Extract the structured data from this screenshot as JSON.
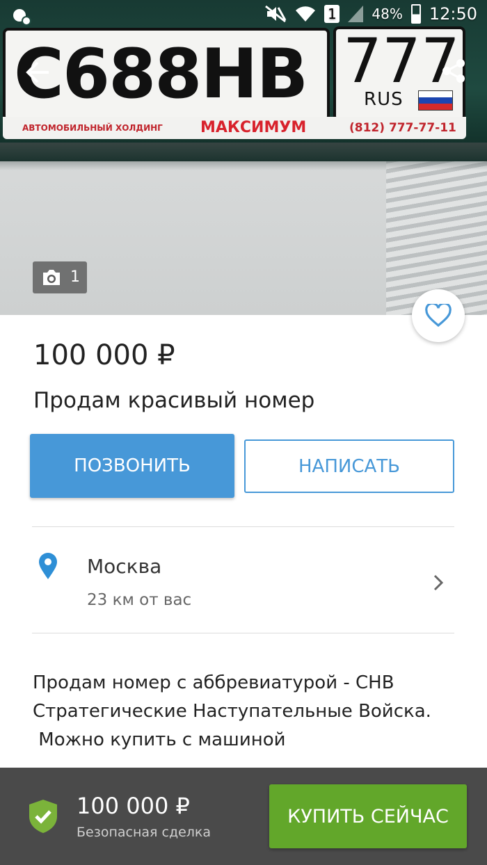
{
  "status_bar": {
    "battery": "48%",
    "time": "12:50",
    "sim": "1"
  },
  "photo": {
    "plate_number": "С688НВ",
    "plate_region": "777",
    "plate_country": "RUS",
    "frame_left": "АВТОМОБИЛЬНЫЙ ХОЛДИНГ",
    "frame_brand": "МАКСИМУМ",
    "frame_phone": "(812) 777-77-11",
    "photo_count": "1"
  },
  "listing": {
    "price": "100 000 ₽",
    "title": "Продам красивый номер"
  },
  "actions": {
    "call_label": "ПОЗВОНИТЬ",
    "write_label": "НАПИСАТЬ"
  },
  "location": {
    "city": "Москва",
    "distance": "23 км от вас"
  },
  "description": "Продам номер с аббревиатурой - СНВ\nСтратегические Наступательные Войска.\n Можно купить с машиной",
  "bottom_bar": {
    "price": "100 000 ₽",
    "subtitle": "Безопасная сделка",
    "buy_label": "КУПИТЬ СЕЙЧАС"
  },
  "colors": {
    "accent_blue": "#4798d8",
    "buy_green": "#62a72a",
    "bottom_bar_bg": "#4a4a4a"
  },
  "icons": [
    "back-arrow-icon",
    "share-icon",
    "camera-icon",
    "heart-icon",
    "location-pin-icon",
    "chevron-right-icon",
    "shield-check-icon"
  ]
}
